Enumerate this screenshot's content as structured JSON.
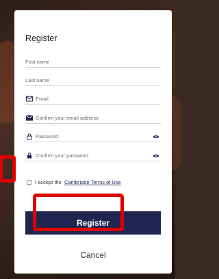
{
  "dialog": {
    "title": "Register",
    "fields": {
      "first_name": {
        "placeholder": "First name"
      },
      "last_name": {
        "placeholder": "Last name"
      },
      "email": {
        "placeholder": "Email",
        "icon": "envelope-outline-icon"
      },
      "confirm_email": {
        "placeholder": "Confirm your email address",
        "icon": "envelope-filled-icon"
      },
      "password": {
        "placeholder": "Password",
        "icon": "lock-outline-icon",
        "toggle_icon": "eye-icon"
      },
      "confirm_password": {
        "placeholder": "Confirm your password",
        "icon": "lock-filled-icon",
        "toggle_icon": "eye-icon"
      }
    },
    "terms": {
      "prefix": "I accept the",
      "link_text": "Cambridge Terms of Use",
      "checked": false
    },
    "register_button": {
      "label": "Register"
    },
    "cancel_button": {
      "label": "Cancel"
    }
  },
  "colors": {
    "primary_button": "#1f2450",
    "highlight": "#e00000",
    "link": "#1f2a5e"
  }
}
